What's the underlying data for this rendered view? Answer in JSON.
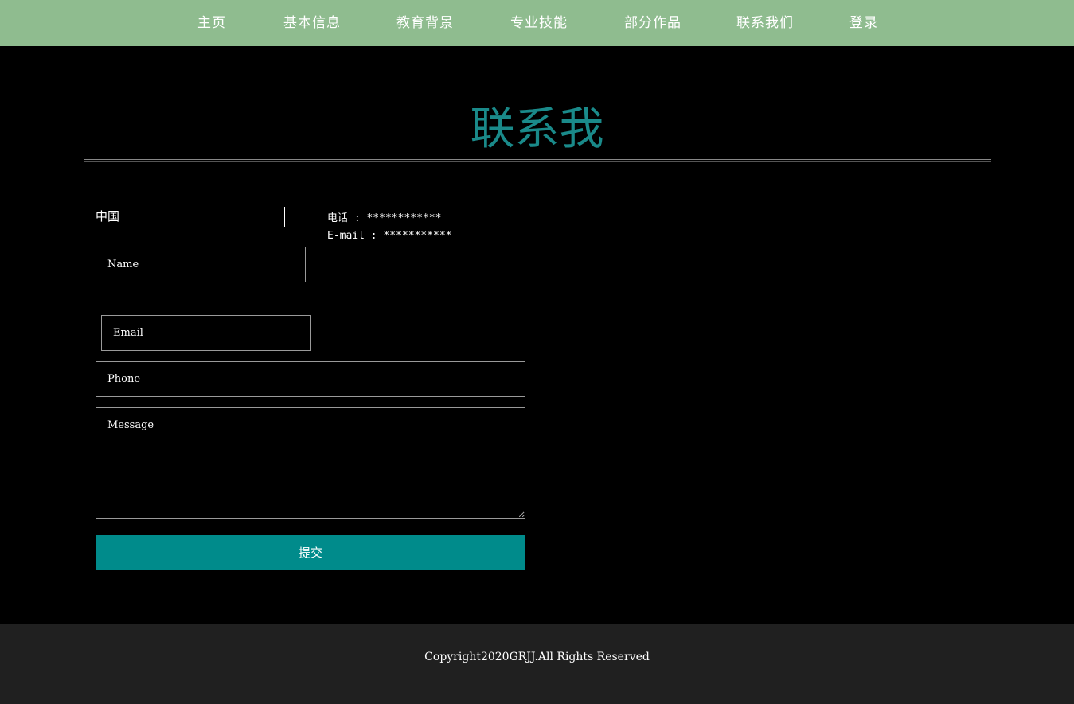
{
  "nav": {
    "items": [
      {
        "label": "主页"
      },
      {
        "label": "基本信息"
      },
      {
        "label": "教育背景"
      },
      {
        "label": "专业技能"
      },
      {
        "label": "部分作品"
      },
      {
        "label": "联系我们"
      },
      {
        "label": "登录"
      }
    ]
  },
  "page": {
    "title": "联系我"
  },
  "contact": {
    "address": "中国",
    "phone": "电话 : ************",
    "email": "E-mail : ***********"
  },
  "form": {
    "name_placeholder": "Name",
    "email_placeholder": "Email",
    "phone_placeholder": "Phone",
    "message_placeholder": "Message",
    "submit_label": "提交"
  },
  "footer": {
    "copyright": "Copyright2020GRJJ.All Rights Reserved"
  },
  "colors": {
    "nav_background": "#8fbc8f",
    "title_color": "#1a8a8a",
    "button_background": "#008b8b",
    "footer_background": "#202020",
    "page_background": "#000000"
  }
}
